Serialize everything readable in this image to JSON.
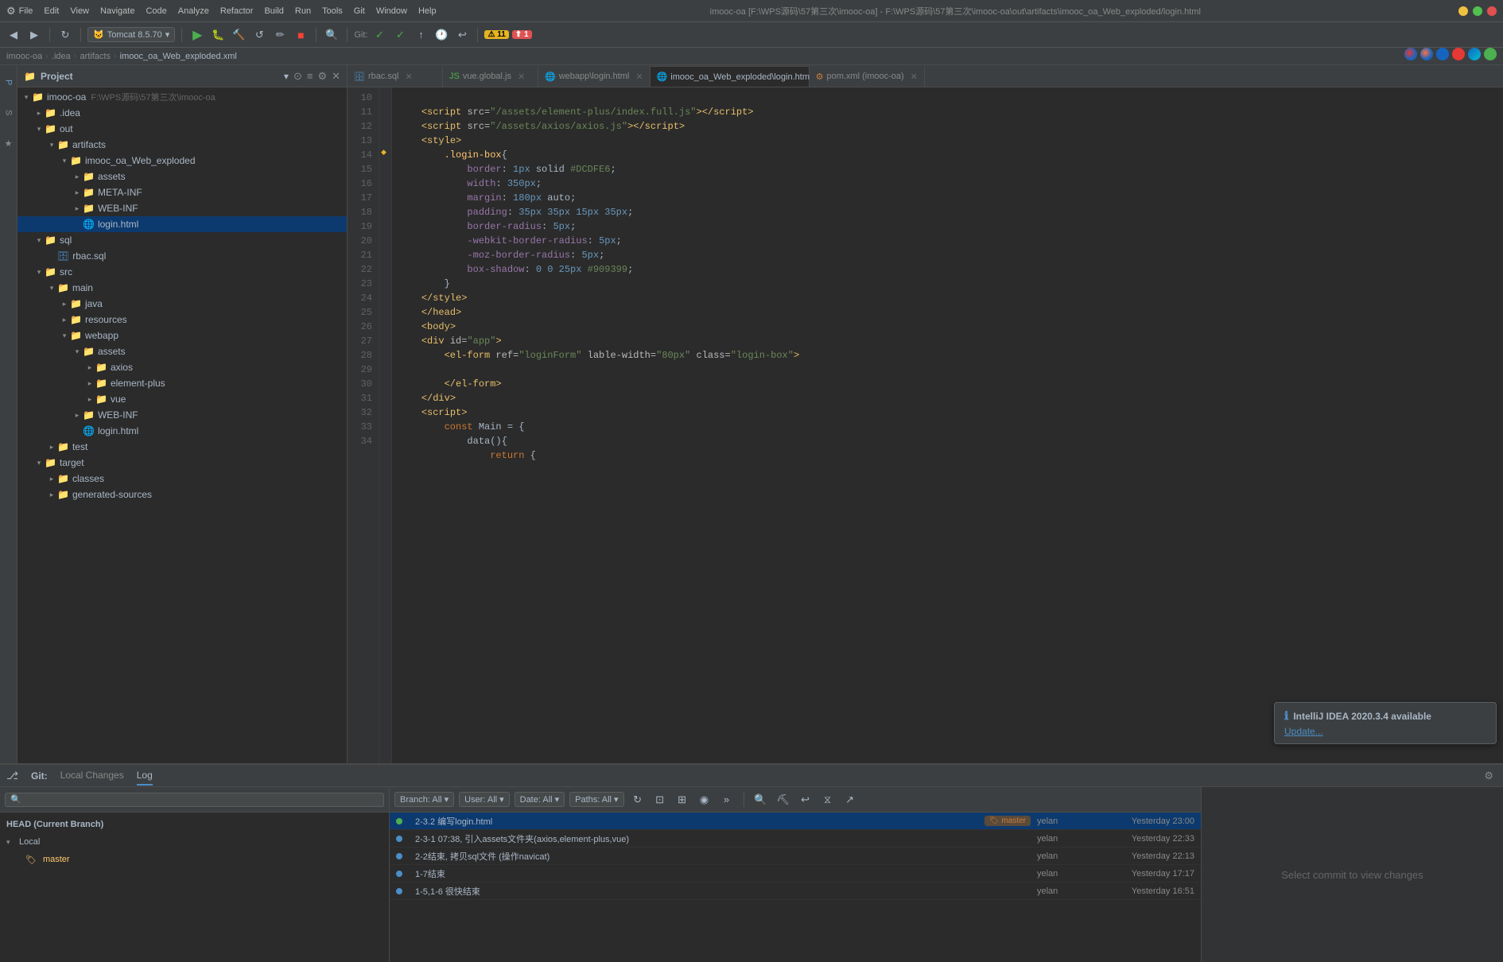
{
  "titlebar": {
    "app_name": "imooc-oa",
    "title": "imooc-oa [F:\\WPS源码\\57第三次\\imooc-oa] - F:\\WPS源码\\57第三次\\imooc-oa\\out\\artifacts\\imooc_oa_Web_exploded/login.html",
    "menu": [
      "File",
      "Edit",
      "View",
      "Navigate",
      "Code",
      "Analyze",
      "Refactor",
      "Build",
      "Run",
      "Tools",
      "Git",
      "Window",
      "Help"
    ]
  },
  "breadcrumb": {
    "items": [
      "imooc-oa",
      ".idea",
      "artifacts",
      "imooc_oa_Web_exploded.xml"
    ]
  },
  "project": {
    "title": "Project",
    "root": {
      "name": "imooc-oa",
      "path": "F:\\WPS源码\\57第三次\\imooc-oa"
    }
  },
  "editor_tabs": [
    {
      "label": "rbac.sql",
      "active": false,
      "icon": "sql"
    },
    {
      "label": "vue.global.js",
      "active": false,
      "icon": "js"
    },
    {
      "label": "webapp\\login.html",
      "active": false,
      "icon": "html"
    },
    {
      "label": "imooc_oa_Web_exploded\\login.html",
      "active": true,
      "icon": "html"
    },
    {
      "label": "pom.xml (imooc-oa)",
      "active": false,
      "icon": "xml"
    }
  ],
  "code_lines": [
    {
      "num": 10,
      "content": "    <script src=\"/assets/element-plus/index.full.js\"><\\/script>"
    },
    {
      "num": 11,
      "content": "    <script src=\"/assets/axios/axios.js\"><\\/script>"
    },
    {
      "num": 12,
      "content": "    <style>"
    },
    {
      "num": 13,
      "content": "        .login-box{"
    },
    {
      "num": 14,
      "content": "            border: 1px solid #DCDFE6;"
    },
    {
      "num": 15,
      "content": "            width: 350px;"
    },
    {
      "num": 16,
      "content": "            margin: 180px auto;"
    },
    {
      "num": 17,
      "content": "            padding: 35px 35px 15px 35px;"
    },
    {
      "num": 18,
      "content": "            border-radius: 5px;"
    },
    {
      "num": 19,
      "content": "            -webkit-border-radius: 5px;"
    },
    {
      "num": 20,
      "content": "            -moz-border-radius: 5px;"
    },
    {
      "num": 21,
      "content": "            box-shadow: 0 0 25px #909399;"
    },
    {
      "num": 22,
      "content": "        }"
    },
    {
      "num": 23,
      "content": "    <\\/style>"
    },
    {
      "num": 24,
      "content": "    <\\/head>"
    },
    {
      "num": 25,
      "content": "    <body>"
    },
    {
      "num": 26,
      "content": "    <div id=\"app\">"
    },
    {
      "num": 27,
      "content": "        <el-form ref=\"loginForm\" lable-width=\"80px\" class=\"login-box\">"
    },
    {
      "num": 28,
      "content": ""
    },
    {
      "num": 29,
      "content": "        <\\/el-form>"
    },
    {
      "num": 30,
      "content": "    <\\/div>"
    },
    {
      "num": 31,
      "content": "    <script>"
    },
    {
      "num": 32,
      "content": "        const Main = {"
    },
    {
      "num": 33,
      "content": "            data(){"
    },
    {
      "num": 34,
      "content": "                return {"
    }
  ],
  "git": {
    "panel_label": "Git:",
    "tabs": [
      "Local Changes",
      "Log"
    ],
    "active_tab": "Log",
    "filters": {
      "branch": "Branch: All",
      "user": "User: All",
      "date": "Date: All",
      "paths": "Paths: All"
    },
    "commits": [
      {
        "hash": "2-3.2",
        "msg": "2-3.2 编写login.html",
        "branch": "master",
        "author": "yelan",
        "date": "Yesterday 23:00",
        "selected": true
      },
      {
        "hash": "2-3-1",
        "msg": "2-3-1 07:38, 引入assets文件夹(axios,element-plus,vue)",
        "author": "yelan",
        "date": "Yesterday 22:33"
      },
      {
        "hash": "2-2",
        "msg": "2-2结束, 拷贝sql文件 (操作navicat)",
        "author": "yelan",
        "date": "Yesterday 22:13"
      },
      {
        "hash": "1-7",
        "msg": "1-7结束",
        "author": "yelan",
        "date": "Yesterday 17:17"
      },
      {
        "hash": "1-5",
        "msg": "1-5,1-6 很快结束",
        "author": "yelan",
        "date": "Yesterday 16:51"
      }
    ],
    "tree": {
      "head": "HEAD (Current Branch)",
      "local_label": "Local",
      "branches": [
        "master"
      ]
    }
  },
  "notification": {
    "icon": "ℹ",
    "title": "IntelliJ IDEA 2020.3.4 available",
    "link": "Update..."
  },
  "statusbar": {
    "warnings": "11",
    "errors": "1",
    "git_label": "Git:",
    "select_commit": "Select commit to view changes"
  },
  "toolbar": {
    "tomcat_label": "Tomcat 8.5.70"
  },
  "tree_items": [
    {
      "level": 0,
      "type": "folder",
      "expanded": true,
      "name": "imooc-oa",
      "hint": "F:\\WPS源码\\57第三次\\imooc-oa",
      "icon": "📁"
    },
    {
      "level": 1,
      "type": "folder",
      "expanded": false,
      "name": ".idea",
      "hint": "",
      "icon": "📁"
    },
    {
      "level": 1,
      "type": "folder",
      "expanded": true,
      "name": "out",
      "hint": "",
      "icon": "📁"
    },
    {
      "level": 2,
      "type": "folder",
      "expanded": true,
      "name": "artifacts",
      "hint": "",
      "icon": "📁"
    },
    {
      "level": 3,
      "type": "folder",
      "expanded": true,
      "name": "imooc_oa_Web_exploded",
      "hint": "",
      "icon": "📁"
    },
    {
      "level": 4,
      "type": "folder",
      "expanded": false,
      "name": "assets",
      "hint": "",
      "icon": "📁"
    },
    {
      "level": 4,
      "type": "folder",
      "expanded": false,
      "name": "META-INF",
      "hint": "",
      "icon": "📁"
    },
    {
      "level": 4,
      "type": "folder",
      "expanded": false,
      "name": "WEB-INF",
      "hint": "",
      "icon": "📁"
    },
    {
      "level": 4,
      "type": "file",
      "name": "login.html",
      "hint": "",
      "icon": "🌐",
      "selected": true
    },
    {
      "level": 1,
      "type": "folder",
      "expanded": true,
      "name": "sql",
      "hint": "",
      "icon": "📁"
    },
    {
      "level": 2,
      "type": "file",
      "name": "rbac.sql",
      "hint": "",
      "icon": "🗄"
    },
    {
      "level": 1,
      "type": "folder",
      "expanded": true,
      "name": "src",
      "hint": "",
      "icon": "📁"
    },
    {
      "level": 2,
      "type": "folder",
      "expanded": true,
      "name": "main",
      "hint": "",
      "icon": "📁"
    },
    {
      "level": 3,
      "type": "folder",
      "expanded": false,
      "name": "java",
      "hint": "",
      "icon": "📁"
    },
    {
      "level": 3,
      "type": "folder",
      "expanded": false,
      "name": "resources",
      "hint": "",
      "icon": "📁"
    },
    {
      "level": 3,
      "type": "folder",
      "expanded": true,
      "name": "webapp",
      "hint": "",
      "icon": "📁"
    },
    {
      "level": 4,
      "type": "folder",
      "expanded": true,
      "name": "assets",
      "hint": "",
      "icon": "📁"
    },
    {
      "level": 5,
      "type": "folder",
      "expanded": false,
      "name": "axios",
      "hint": "",
      "icon": "📁"
    },
    {
      "level": 5,
      "type": "folder",
      "expanded": false,
      "name": "element-plus",
      "hint": "",
      "icon": "📁"
    },
    {
      "level": 5,
      "type": "folder",
      "expanded": false,
      "name": "vue",
      "hint": "",
      "icon": "📁"
    },
    {
      "level": 4,
      "type": "folder",
      "expanded": false,
      "name": "WEB-INF",
      "hint": "",
      "icon": "📁"
    },
    {
      "level": 4,
      "type": "file",
      "name": "login.html",
      "hint": "",
      "icon": "🌐"
    },
    {
      "level": 2,
      "type": "folder",
      "expanded": false,
      "name": "test",
      "hint": "",
      "icon": "📁"
    },
    {
      "level": 1,
      "type": "folder",
      "expanded": true,
      "name": "target",
      "hint": "",
      "icon": "📁"
    },
    {
      "level": 2,
      "type": "folder",
      "expanded": false,
      "name": "classes",
      "hint": "",
      "icon": "📁"
    },
    {
      "level": 2,
      "type": "folder",
      "expanded": false,
      "name": "generated-sources",
      "hint": "",
      "icon": "📁"
    }
  ]
}
